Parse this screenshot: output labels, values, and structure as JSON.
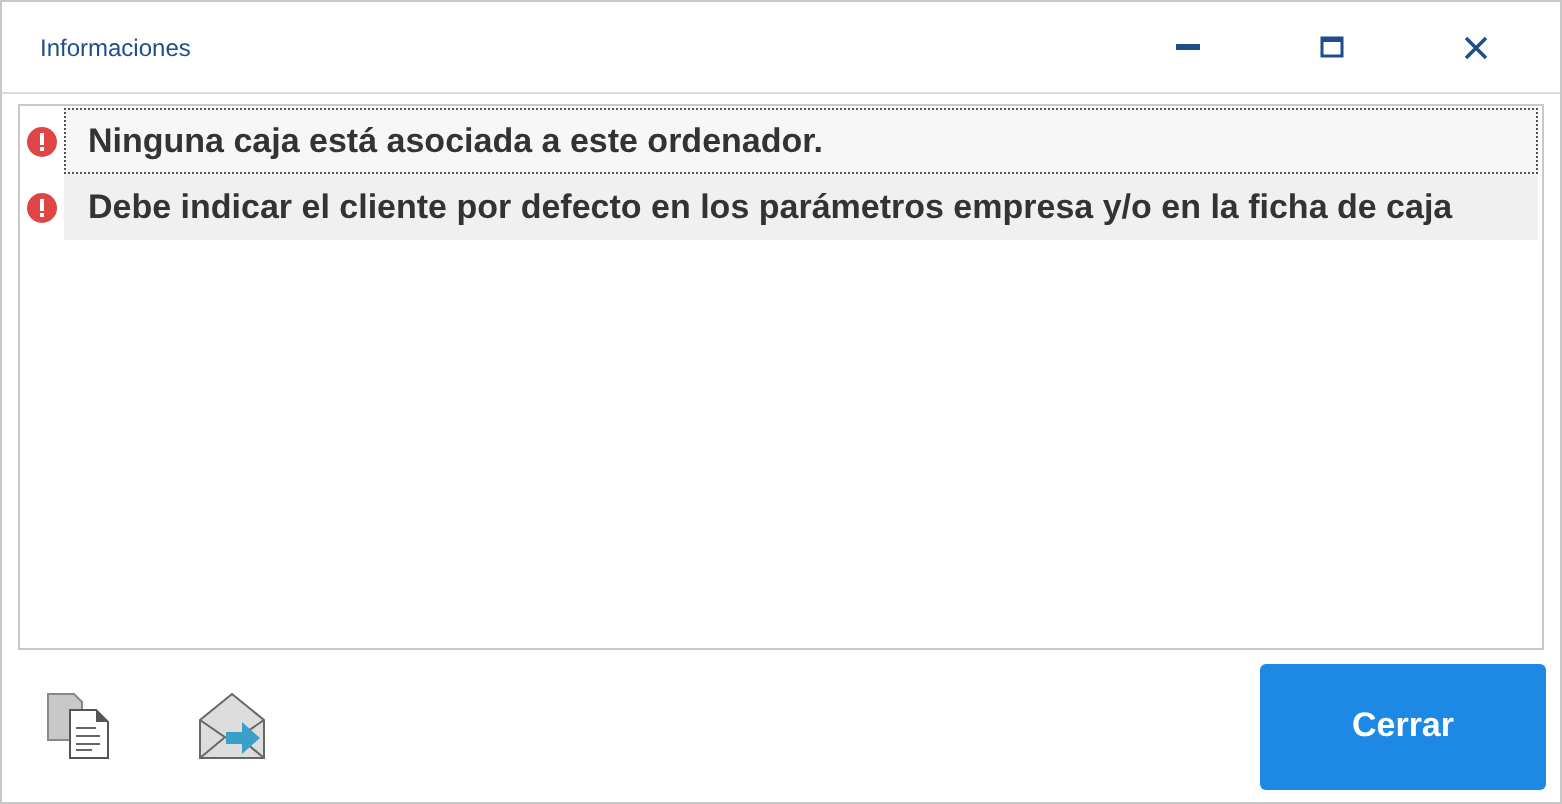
{
  "window": {
    "title": "Informaciones"
  },
  "messages": [
    {
      "kind": "error",
      "text": "Ninguna caja está asociada a este ordenador.",
      "selected": true
    },
    {
      "kind": "error",
      "text": "Debe indicar el cliente por defecto en los parámetros empresa y/o en la ficha de caja",
      "selected": false
    }
  ],
  "buttons": [
    {
      "label": "Cerrar"
    }
  ]
}
